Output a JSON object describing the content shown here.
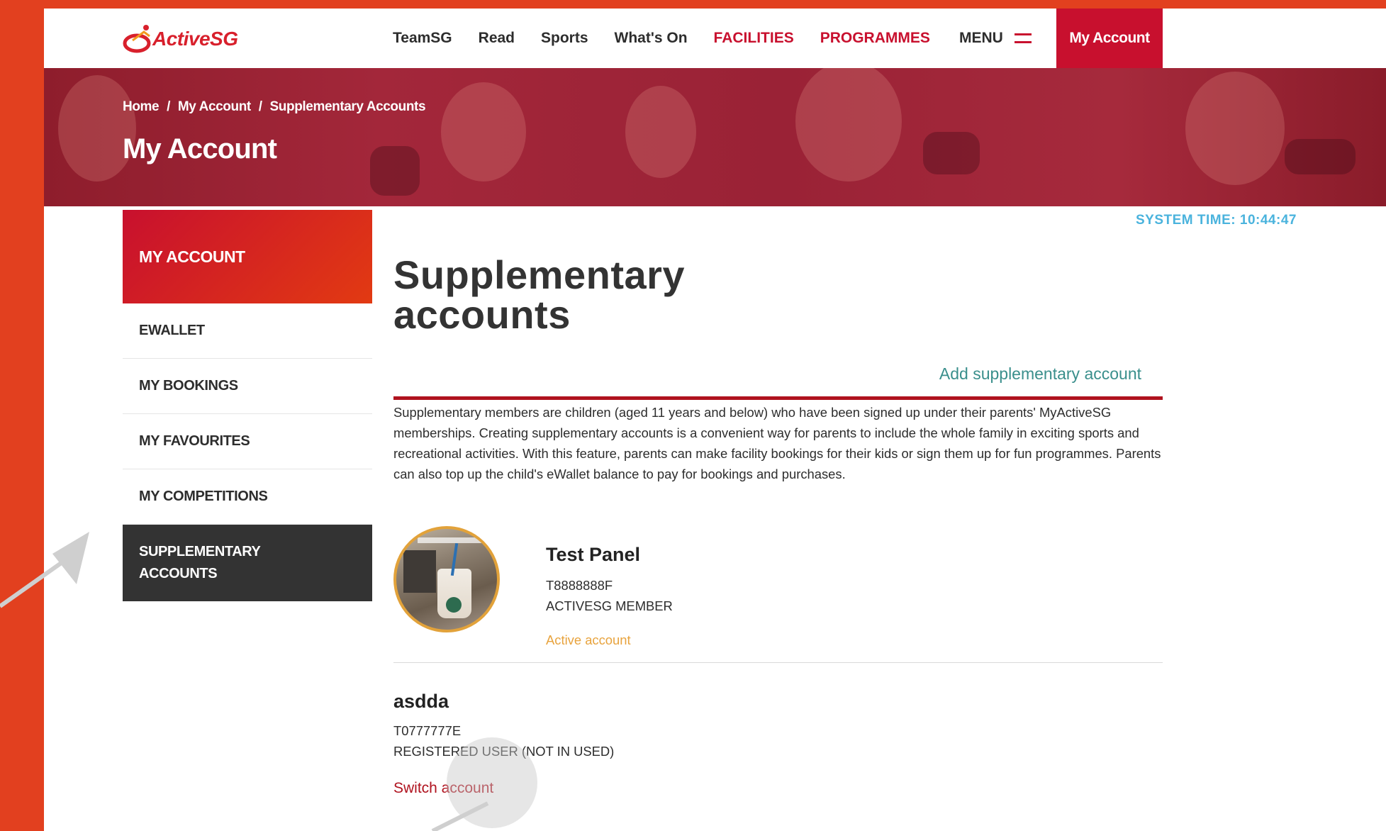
{
  "logo": {
    "text": "ActiveSG"
  },
  "nav": {
    "items": [
      "TeamSG",
      "Read",
      "Sports",
      "What's On"
    ],
    "facilities": "FACILITIES",
    "programmes": "PROGRAMMES",
    "menu_label": "MENU",
    "account_button": "My Account"
  },
  "breadcrumb": {
    "home": "Home",
    "sep": "/",
    "account": "My Account",
    "current": "Supplementary Accounts"
  },
  "hero": {
    "title": "My Account"
  },
  "sidebar": {
    "heading": "MY ACCOUNT",
    "items": [
      "EWALLET",
      "MY BOOKINGS",
      "MY FAVOURITES",
      "MY COMPETITIONS"
    ],
    "active_line1": "SUPPLEMENTARY",
    "active_line2": "ACCOUNTS"
  },
  "system_time": "SYSTEM TIME: 10:44:47",
  "main": {
    "title_line1": "Supplementary",
    "title_line2": "accounts",
    "add_link": "Add supplementary account",
    "description": "Supplementary members are children (aged 11 years and below) who have been signed up under their parents' MyActiveSG memberships. Creating supplementary accounts is a convenient way for parents to include the whole family in exciting sports and recreational activities. With this feature, parents can make facility bookings for their kids or sign them up for fun programmes. Parents can also top up the child's eWallet balance to pay for bookings and purchases."
  },
  "member": {
    "name": "Test Panel",
    "id": "T8888888F",
    "type": "ACTIVESG MEMBER",
    "status": "Active account"
  },
  "supplementary": {
    "name": "asdda",
    "id": "T0777777E",
    "type": "REGISTERED USER (NOT IN USED)",
    "switch_label": "Switch account"
  },
  "colors": {
    "brand_red": "#c8102e",
    "frame_orange": "#e2401f",
    "status_orange": "#e8a33d",
    "teal_link": "#3a8f8c",
    "time_blue": "#4ab3dd"
  }
}
